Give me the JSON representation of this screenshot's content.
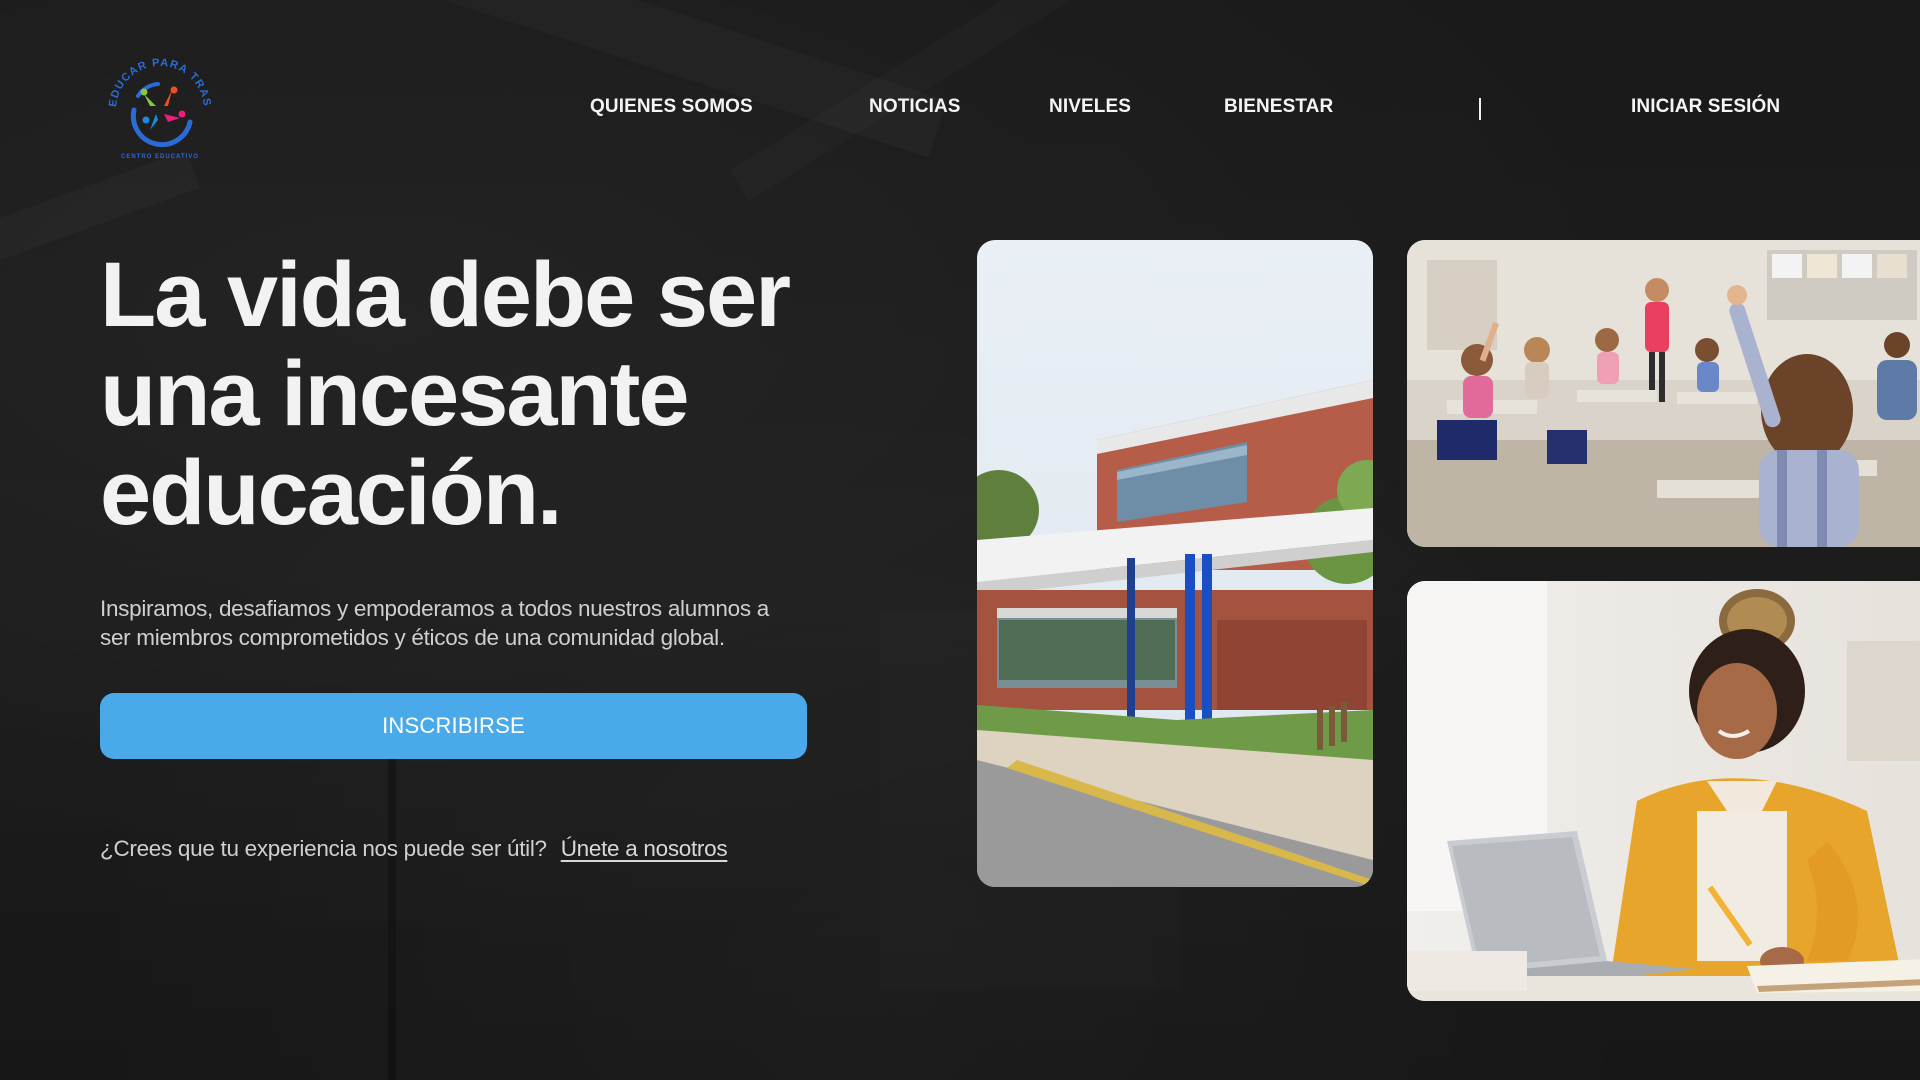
{
  "brand": {
    "logo_ring_text": "EDUCAR PARA TRASFORMAR",
    "logo_sub_text": "CENTRO EDUCATIVO",
    "logo_colors": [
      "#f04e23",
      "#8bc53f",
      "#ec1e79",
      "#1e88e5",
      "#2b6bd6"
    ]
  },
  "nav": {
    "items": [
      {
        "label": "QUIENES SOMOS"
      },
      {
        "label": "NOTICIAS"
      },
      {
        "label": "NIVELES"
      },
      {
        "label": "BIENESTAR"
      }
    ],
    "login_label": "INICIAR SESIÓN"
  },
  "hero": {
    "title_lines": [
      "La vida debe ser",
      "una incesante",
      "educación."
    ],
    "subtitle_lines": [
      "Inspiramos, desafiamos y empoderamos a todos nuestros alumnos a",
      "ser miembros comprometidos y éticos de una comunidad global."
    ],
    "cta_label": "INSCRIBIRSE",
    "join_prompt": "¿Crees que tu experiencia nos puede ser útil?",
    "join_link": "Únete a nosotros",
    "cta_color": "#4aa9e9"
  },
  "photos": {
    "school_building": "school-building-photo",
    "classroom": "classroom-students-photo",
    "student": "student-laptop-photo"
  }
}
